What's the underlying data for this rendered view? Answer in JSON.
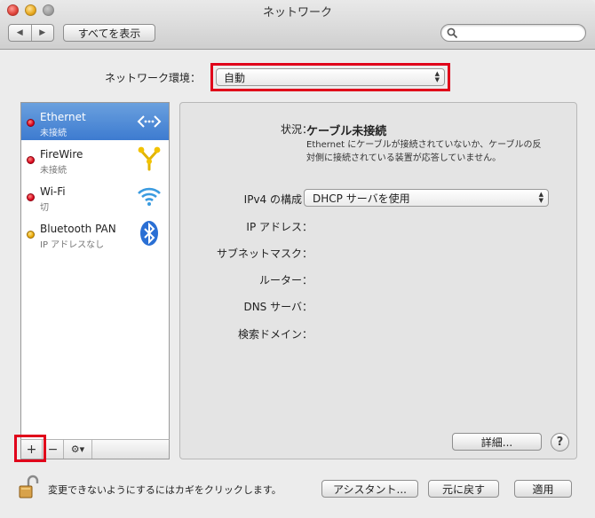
{
  "window": {
    "title": "ネットワーク"
  },
  "toolbar": {
    "back_glyph": "◀",
    "forward_glyph": "▶",
    "show_all_label": "すべてを表示",
    "search_value": ""
  },
  "location": {
    "label": "ネットワーク環境：",
    "value": "自動"
  },
  "services": [
    {
      "name": "Ethernet",
      "status": "未接続",
      "dot_color": "red",
      "icon": "ethernet-icon",
      "selected": true
    },
    {
      "name": "FireWire",
      "status": "未接続",
      "dot_color": "red",
      "icon": "firewire-icon",
      "selected": false
    },
    {
      "name": "Wi-Fi",
      "status": "切",
      "dot_color": "red",
      "icon": "wifi-icon",
      "selected": false
    },
    {
      "name": "Bluetooth PAN",
      "status": "IP アドレスなし",
      "dot_color": "yellow",
      "icon": "bluetooth-icon",
      "selected": false
    }
  ],
  "sidebar_buttons": {
    "add": "+",
    "remove": "−",
    "gear": "⚙▾"
  },
  "detail": {
    "status_label": "状況：",
    "status_value": "ケーブル未接続",
    "status_desc_line1": "Ethernet にケーブルが接続されていないか、ケーブルの反",
    "status_desc_line2": "対側に接続されている装置が応答していません。",
    "ipv4_label": "IPv4 の構成：",
    "ipv4_value": "DHCP サーバを使用",
    "ip_label": "IP アドレス：",
    "subnet_label": "サブネットマスク：",
    "router_label": "ルーター：",
    "dns_label": "DNS サーバ：",
    "search_domain_label": "検索ドメイン：",
    "advanced_label": "詳細...",
    "help_label": "?"
  },
  "footer": {
    "lock_text": "変更できないようにするにはカギをクリックします。",
    "assistant_label": "アシスタント...",
    "revert_label": "元に戻す",
    "apply_label": "適用"
  },
  "colors": {
    "selection": "#3d7bd0",
    "highlight_box": "#e0001a",
    "status_red": "#d8001a",
    "status_yellow": "#e6a400"
  }
}
